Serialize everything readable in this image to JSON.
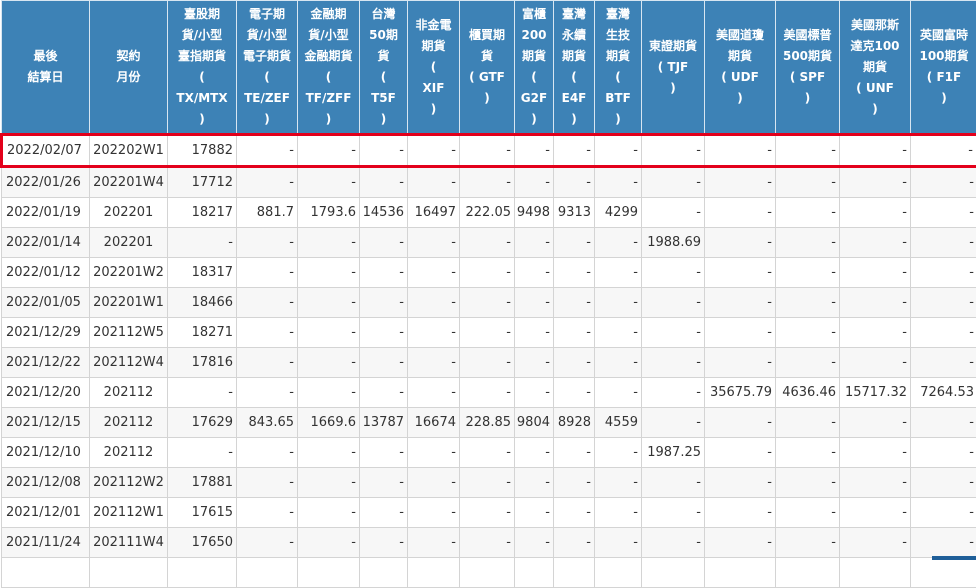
{
  "table": {
    "headers": [
      [
        "最後",
        "結算日"
      ],
      [
        "契約",
        "月份"
      ],
      [
        "臺股期",
        "貨/小型",
        "臺指期貨",
        "(",
        "TX/MTX",
        ")"
      ],
      [
        "電子期",
        "貨/小型",
        "電子期貨",
        "(",
        "TE/ZEF",
        ")"
      ],
      [
        "金融期",
        "貨/小型",
        "金融期貨",
        "(",
        "TF/ZFF",
        ")"
      ],
      [
        "台灣",
        "50期",
        "貨",
        "(",
        "T5F",
        ")"
      ],
      [
        "非金電",
        "期貨",
        "(",
        "XIF",
        ")"
      ],
      [
        "櫃買期",
        "貨",
        "( GTF",
        ")"
      ],
      [
        "富櫃",
        "200",
        "期貨",
        "(",
        "G2F",
        ")"
      ],
      [
        "臺灣",
        "永續",
        "期貨",
        "(",
        "E4F",
        ")"
      ],
      [
        "臺灣",
        "生技",
        "期貨",
        "(",
        "BTF",
        ")"
      ],
      [
        "東證期貨",
        "( TJF",
        ")"
      ],
      [
        "美國道瓊",
        "期貨",
        "( UDF",
        ")"
      ],
      [
        "美國標普",
        "500期貨",
        "( SPF",
        ")"
      ],
      [
        "美國那斯",
        "達克100",
        "期貨",
        "( UNF",
        ")"
      ],
      [
        "英國富時",
        "100期貨",
        "( F1F",
        ")"
      ]
    ],
    "rows": [
      [
        "2022/02/07",
        "202202W1",
        "17882",
        "-",
        "-",
        "-",
        "-",
        "-",
        "-",
        "-",
        "-",
        "-",
        "-",
        "-",
        "-",
        "-"
      ],
      [
        "2022/01/26",
        "202201W4",
        "17712",
        "-",
        "-",
        "-",
        "-",
        "-",
        "-",
        "-",
        "-",
        "-",
        "-",
        "-",
        "-",
        "-"
      ],
      [
        "2022/01/19",
        "202201",
        "18217",
        "881.7",
        "1793.6",
        "14536",
        "16497",
        "222.05",
        "9498",
        "9313",
        "4299",
        "-",
        "-",
        "-",
        "-",
        "-"
      ],
      [
        "2022/01/14",
        "202201",
        "-",
        "-",
        "-",
        "-",
        "-",
        "-",
        "-",
        "-",
        "-",
        "1988.69",
        "-",
        "-",
        "-",
        "-"
      ],
      [
        "2022/01/12",
        "202201W2",
        "18317",
        "-",
        "-",
        "-",
        "-",
        "-",
        "-",
        "-",
        "-",
        "-",
        "-",
        "-",
        "-",
        "-"
      ],
      [
        "2022/01/05",
        "202201W1",
        "18466",
        "-",
        "-",
        "-",
        "-",
        "-",
        "-",
        "-",
        "-",
        "-",
        "-",
        "-",
        "-",
        "-"
      ],
      [
        "2021/12/29",
        "202112W5",
        "18271",
        "-",
        "-",
        "-",
        "-",
        "-",
        "-",
        "-",
        "-",
        "-",
        "-",
        "-",
        "-",
        "-"
      ],
      [
        "2021/12/22",
        "202112W4",
        "17816",
        "-",
        "-",
        "-",
        "-",
        "-",
        "-",
        "-",
        "-",
        "-",
        "-",
        "-",
        "-",
        "-"
      ],
      [
        "2021/12/20",
        "202112",
        "-",
        "-",
        "-",
        "-",
        "-",
        "-",
        "-",
        "-",
        "-",
        "-",
        "35675.79",
        "4636.46",
        "15717.32",
        "7264.53"
      ],
      [
        "2021/12/15",
        "202112",
        "17629",
        "843.65",
        "1669.6",
        "13787",
        "16674",
        "228.85",
        "9804",
        "8928",
        "4559",
        "-",
        "-",
        "-",
        "-",
        "-"
      ],
      [
        "2021/12/10",
        "202112",
        "-",
        "-",
        "-",
        "-",
        "-",
        "-",
        "-",
        "-",
        "-",
        "1987.25",
        "-",
        "-",
        "-",
        "-"
      ],
      [
        "2021/12/08",
        "202112W2",
        "17881",
        "-",
        "-",
        "-",
        "-",
        "-",
        "-",
        "-",
        "-",
        "-",
        "-",
        "-",
        "-",
        "-"
      ],
      [
        "2021/12/01",
        "202112W1",
        "17615",
        "-",
        "-",
        "-",
        "-",
        "-",
        "-",
        "-",
        "-",
        "-",
        "-",
        "-",
        "-",
        "-"
      ],
      [
        "2021/11/24",
        "202111W4",
        "17650",
        "-",
        "-",
        "-",
        "-",
        "-",
        "-",
        "-",
        "-",
        "-",
        "-",
        "-",
        "-",
        "-"
      ],
      [
        "",
        "",
        "",
        "",
        "",
        "",
        "",
        "",
        "",
        "",
        "",
        "",
        "",
        "",
        "",
        ""
      ]
    ],
    "highlighted_row": 0,
    "colors": {
      "header_bg": "#3d82b6",
      "highlight_border": "#e3001b"
    }
  }
}
